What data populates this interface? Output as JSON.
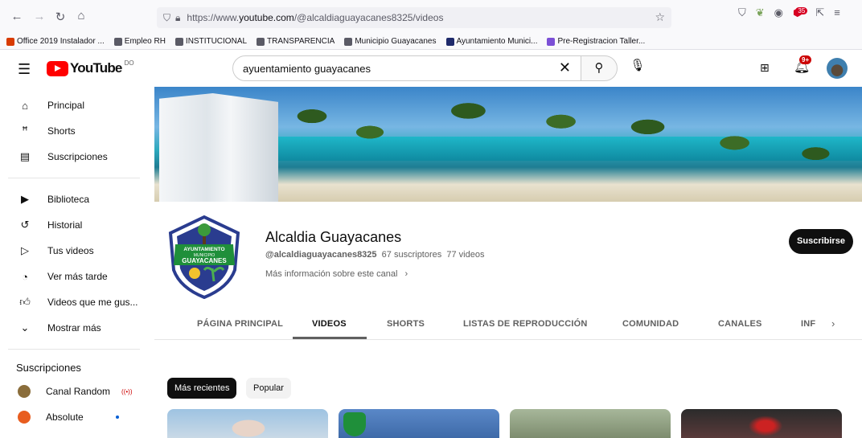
{
  "browser": {
    "url_prefix": "https://www.",
    "url_host": "youtube.com",
    "url_path": "/@alcaldiaguayacanes8325/videos",
    "ext_badge": "35",
    "bookmarks": [
      {
        "label": "Office 2019 Instalador ...",
        "color": "#d83b01"
      },
      {
        "label": "Empleo RH",
        "color": "#5b5b66"
      },
      {
        "label": "INSTITUCIONAL",
        "color": "#5b5b66"
      },
      {
        "label": "TRANSPARENCIA",
        "color": "#5b5b66"
      },
      {
        "label": "Municipio Guayacanes",
        "color": "#5b5b66"
      },
      {
        "label": "Ayuntamiento Munici...",
        "color": "#1f2a6b"
      },
      {
        "label": "Pre-Registracion Taller...",
        "color": "#7b4fd6"
      }
    ]
  },
  "header": {
    "logo_text": "YouTube",
    "logo_country": "DO",
    "search_value": "ayuentamiento guayacanes",
    "bell_badge": "9+"
  },
  "sidebar": {
    "main": [
      {
        "label": "Principal",
        "icon": "home-icon"
      },
      {
        "label": "Shorts",
        "icon": "shorts-icon"
      },
      {
        "label": "Suscripciones",
        "icon": "subscriptions-icon"
      }
    ],
    "library": [
      {
        "label": "Biblioteca",
        "icon": "library-icon"
      },
      {
        "label": "Historial",
        "icon": "history-icon"
      },
      {
        "label": "Tus videos",
        "icon": "your-videos-icon"
      },
      {
        "label": "Ver más tarde",
        "icon": "watch-later-icon"
      },
      {
        "label": "Videos que me gus...",
        "icon": "like-icon"
      },
      {
        "label": "Mostrar más",
        "icon": "chevron-down-icon"
      }
    ],
    "subs_title": "Suscripciones",
    "subs": [
      {
        "label": "Canal Random",
        "color": "#8a6d3b",
        "status": "live"
      },
      {
        "label": "Absolute",
        "color": "#e85d1f",
        "status": "new"
      }
    ]
  },
  "channel": {
    "name": "Alcaldia Guayacanes",
    "handle": "@alcaldiaguayacanes8325",
    "subscribers": "67 suscriptores",
    "videos": "77 videos",
    "more_info": "Más información sobre este canal",
    "subscribe_label": "Suscribirse",
    "logo_text_top": "AYUNTAMIENTO",
    "logo_text_mid": "MUNICIPIO",
    "logo_text_main": "GUAYACANES"
  },
  "tabs": [
    {
      "label": "PÁGINA PRINCIPAL",
      "active": false
    },
    {
      "label": "VIDEOS",
      "active": true
    },
    {
      "label": "SHORTS",
      "active": false
    },
    {
      "label": "LISTAS DE REPRODUCCIÓN",
      "active": false
    },
    {
      "label": "COMUNIDAD",
      "active": false
    },
    {
      "label": "CANALES",
      "active": false
    },
    {
      "label": "INF",
      "active": false
    }
  ],
  "chips": {
    "selected": "Más recientes",
    "other": "Popular"
  },
  "colors": {
    "accent": "#ff0000",
    "subscribe_bg": "#0f0f0f",
    "badge": "#cc0000"
  }
}
